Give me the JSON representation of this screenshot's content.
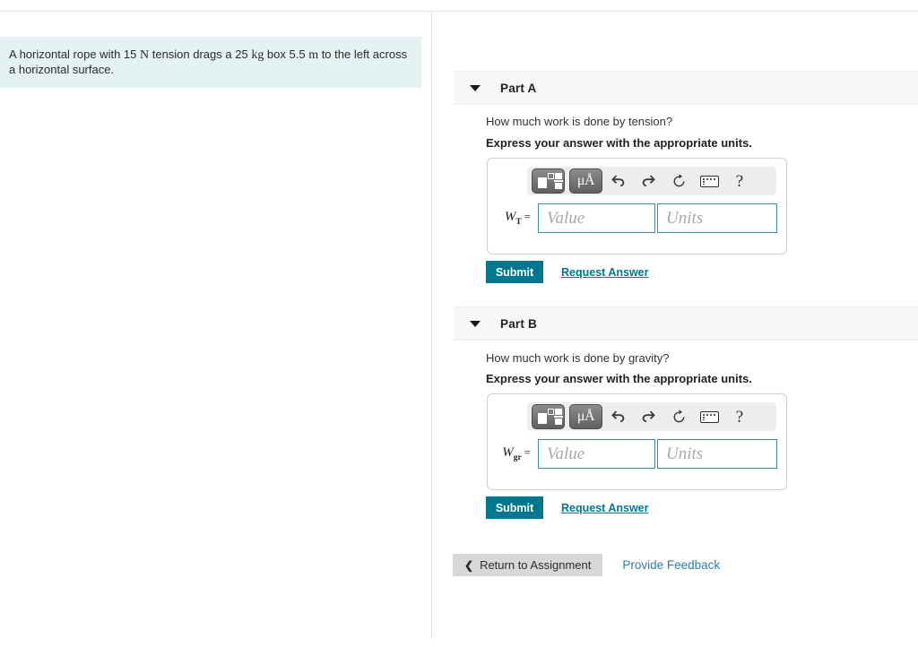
{
  "problem": {
    "text_parts": [
      {
        "t": "A horizontal rope with 15 ",
        "math": false
      },
      {
        "t": "N",
        "math": true
      },
      {
        "t": " tension drags a 25 ",
        "math": false
      },
      {
        "t": "kg",
        "math": true
      },
      {
        "t": " box 5.5 ",
        "math": false
      },
      {
        "t": "m",
        "math": true
      },
      {
        "t": " to the left across a horizontal surface.",
        "math": false
      }
    ],
    "full_text": "A horizontal rope with 15 N tension drags a 25 kg box 5.5 m to the left across a horizontal surface."
  },
  "parts": [
    {
      "header": "Part A",
      "caret_icon": "caret-down-icon",
      "question": "How much work is done by tension?",
      "instruction": "Express your answer with the appropriate units.",
      "variable": "W",
      "subscript": "T",
      "equals": "=",
      "value_placeholder": "Value",
      "units_placeholder": "Units",
      "value_current": "",
      "units_current": "",
      "submit_label": "Submit",
      "request_label": "Request Answer"
    },
    {
      "header": "Part B",
      "caret_icon": "caret-down-icon",
      "question": "How much work is done by gravity?",
      "instruction": "Express your answer with the appropriate units.",
      "variable": "W",
      "subscript": "gr",
      "equals": "=",
      "value_placeholder": "Value",
      "units_placeholder": "Units",
      "value_current": "",
      "units_current": "",
      "submit_label": "Submit",
      "request_label": "Request Answer"
    }
  ],
  "toolbar": {
    "buttons": [
      {
        "name": "math-template-icon",
        "label": ""
      },
      {
        "name": "units-micro-angstrom-icon",
        "label": "μÅ"
      },
      {
        "name": "undo-icon",
        "label": ""
      },
      {
        "name": "redo-icon",
        "label": ""
      },
      {
        "name": "reset-icon",
        "label": ""
      },
      {
        "name": "keyboard-icon",
        "label": ""
      },
      {
        "name": "help-icon",
        "label": "?"
      }
    ],
    "help_glyph": "?"
  },
  "footer": {
    "return_label": "Return to Assignment",
    "return_chevron": "❮",
    "feedback_label": "Provide Feedback"
  },
  "colors": {
    "accent_teal": "#00788f",
    "problem_bg": "#e4f2f2",
    "header_bg": "#f7f7f7",
    "field_border": "#3f8ba3",
    "link_blue": "#2b7fa8"
  }
}
